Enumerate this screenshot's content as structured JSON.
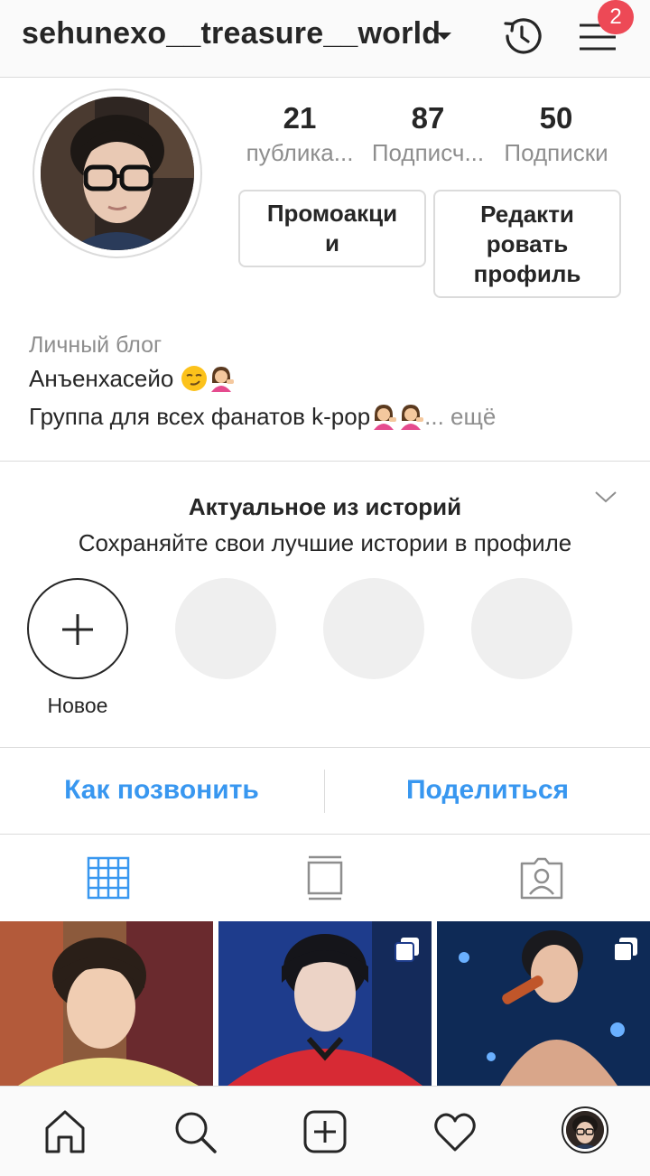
{
  "header": {
    "username": "sehunexo__treasure__world",
    "notification_count": "2"
  },
  "profile": {
    "stats": [
      {
        "value": "21",
        "label": "публика..."
      },
      {
        "value": "87",
        "label": "Подписч..."
      },
      {
        "value": "50",
        "label": "Подписки"
      }
    ],
    "promo_button": "Промоакци\nи",
    "edit_button": "Редакти\nровать\nпрофиль"
  },
  "bio": {
    "category": "Личный блог",
    "line1": "Анъенхасейо",
    "line2": "Группа для всех фанатов k-pop",
    "more": "... ещё"
  },
  "highlights": {
    "title": "Актуальное из историй",
    "subtitle": "Сохраняйте свои лучшие истории в профиле",
    "new_label": "Новое"
  },
  "actions": {
    "call": "Как позвонить",
    "share": "Поделиться"
  },
  "colors": {
    "accent": "#3897f0",
    "badge": "#ed4956",
    "muted": "#8e8e8e",
    "border": "#dbdbdb"
  },
  "icons": {
    "history": "history-icon",
    "menu": "hamburger-menu-icon",
    "grid": "grid-icon",
    "feed": "feed-icon",
    "tagged": "tagged-icon",
    "home": "home-icon",
    "search": "search-icon",
    "add": "add-post-icon",
    "activity": "heart-icon"
  }
}
